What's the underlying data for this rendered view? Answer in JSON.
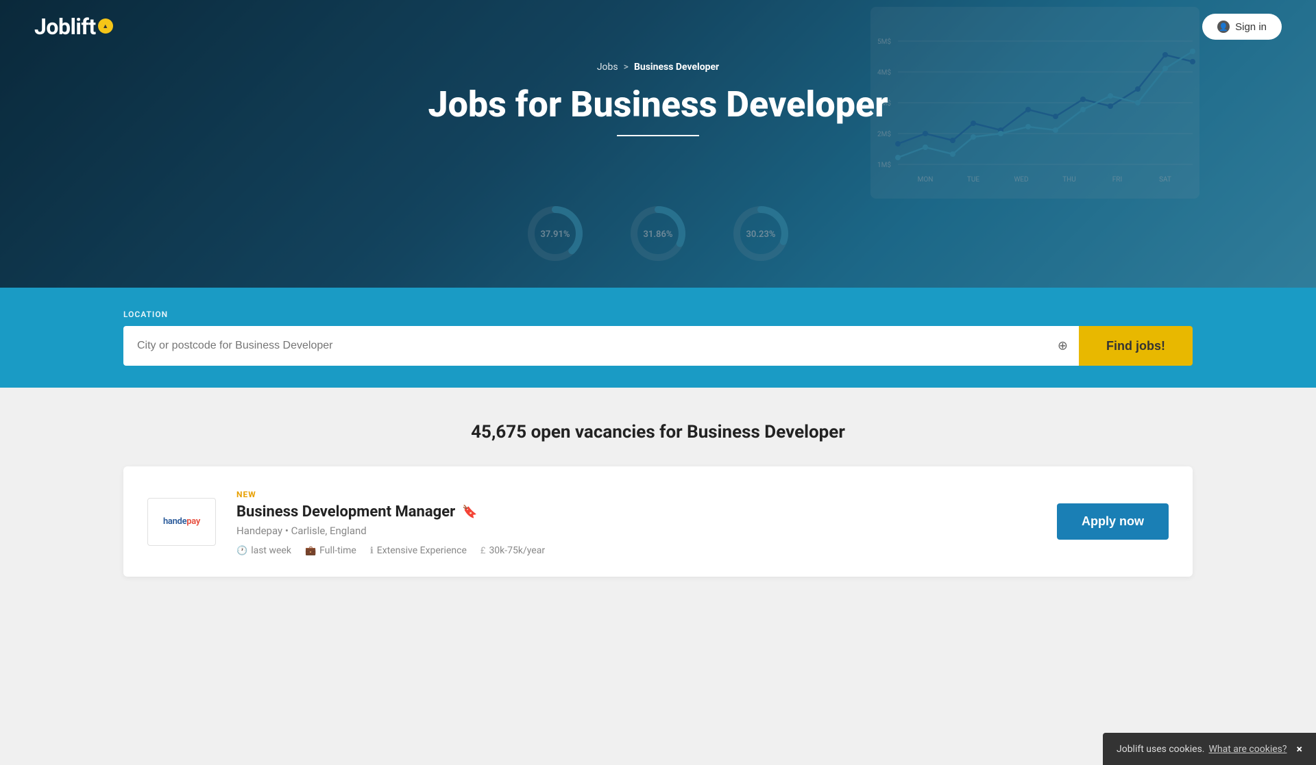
{
  "header": {
    "logo_text": "Joblift",
    "sign_in_label": "Sign in"
  },
  "hero": {
    "breadcrumb": {
      "jobs_label": "Jobs",
      "separator": ">",
      "current_label": "Business Developer"
    },
    "title": "Jobs for Business Developer"
  },
  "search": {
    "location_label": "LOCATION",
    "input_placeholder": "City or postcode for Business Developer",
    "find_jobs_label": "Find jobs!"
  },
  "results": {
    "vacancies_text": "45,675 open vacancies for Business Developer"
  },
  "job_card": {
    "company_logo_text": "handepay",
    "new_badge": "NEW",
    "title": "Business Development Manager",
    "company": "Handepay",
    "location": "Carlisle, England",
    "meta": [
      {
        "icon": "clock",
        "text": "last week"
      },
      {
        "icon": "briefcase",
        "text": "Full-time"
      },
      {
        "icon": "info",
        "text": "Extensive Experience"
      },
      {
        "icon": "pound",
        "text": "30k-75k/year"
      }
    ],
    "apply_label": "Apply now"
  },
  "cookie": {
    "text": "Joblift uses cookies.",
    "link_text": "What are cookies?",
    "close": "×"
  }
}
